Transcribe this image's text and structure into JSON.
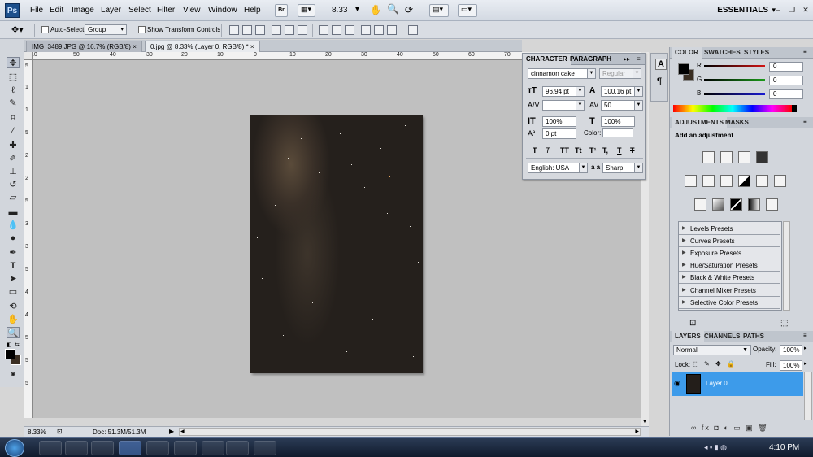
{
  "app": {
    "logo": "Ps"
  },
  "menu": [
    "File",
    "Edit",
    "Image",
    "Layer",
    "Select",
    "Filter",
    "View",
    "Window",
    "Help"
  ],
  "topbar": {
    "br_label": "Br",
    "zoom": "8.33",
    "workspace": "ESSENTIALS"
  },
  "options": {
    "auto_select_label": "Auto-Select:",
    "auto_select_value": "Group",
    "show_transform_label": "Show Transform Controls"
  },
  "tabs": [
    {
      "label": "IMG_3489.JPG @ 16.7% (RGB/8)",
      "close": "×"
    },
    {
      "label": "0.jpg @ 8.33% (Layer 0, RGB/8) *",
      "close": "×"
    }
  ],
  "ruler": {
    "h_labels": [
      "10",
      "50",
      "40",
      "30",
      "20",
      "10",
      "0",
      "10",
      "20",
      "30",
      "40",
      "50",
      "60",
      "70"
    ],
    "v_labels": [
      "5",
      "1",
      "1",
      "5",
      "2",
      "2",
      "5",
      "3",
      "3",
      "5",
      "4",
      "4",
      "5",
      "5",
      "5"
    ]
  },
  "status": {
    "zoom": "8.33%",
    "doc": "Doc: 51.3M/51.3M"
  },
  "character": {
    "tabs": [
      "CHARACTER",
      "PARAGRAPH"
    ],
    "font_family": "cinnamon cake",
    "font_style": "Regular",
    "font_size": "96.94 pt",
    "leading": "100.16 pt",
    "kerning": "",
    "tracking": "50",
    "vscale": "100%",
    "hscale": "100%",
    "baseline": "0 pt",
    "color_label": "Color:",
    "language": "English: USA",
    "aa_label": "a a",
    "antialias": "Sharp",
    "type_buttons": [
      "T",
      "T",
      "TT",
      "Tt",
      "T¹",
      "T,",
      "T",
      "T"
    ]
  },
  "color_panel": {
    "tabs": [
      "COLOR",
      "SWATCHES",
      "STYLES"
    ],
    "channels": [
      {
        "name": "R",
        "value": "0",
        "color": "#d21414"
      },
      {
        "name": "G",
        "value": "0",
        "color": "#1a9a1a"
      },
      {
        "name": "B",
        "value": "0",
        "color": "#1a1ad2"
      }
    ]
  },
  "adjustments": {
    "tabs": [
      "ADJUSTMENTS",
      "MASKS"
    ],
    "heading": "Add an adjustment",
    "presets": [
      "Levels Presets",
      "Curves Presets",
      "Exposure Presets",
      "Hue/Saturation Presets",
      "Black & White Presets",
      "Channel Mixer Presets",
      "Selective Color Presets"
    ]
  },
  "layers": {
    "tabs": [
      "LAYERS",
      "CHANNELS",
      "PATHS"
    ],
    "blend_mode": "Normal",
    "opacity_label": "Opacity:",
    "opacity": "100%",
    "lock_label": "Lock:",
    "fill_label": "Fill:",
    "fill": "100%",
    "layer_name": "Layer 0",
    "footer_icons": "∞ fx ◘ ◐ ▭ ▣ 🗑"
  },
  "taskbar": {
    "time": "4:10 PM"
  }
}
